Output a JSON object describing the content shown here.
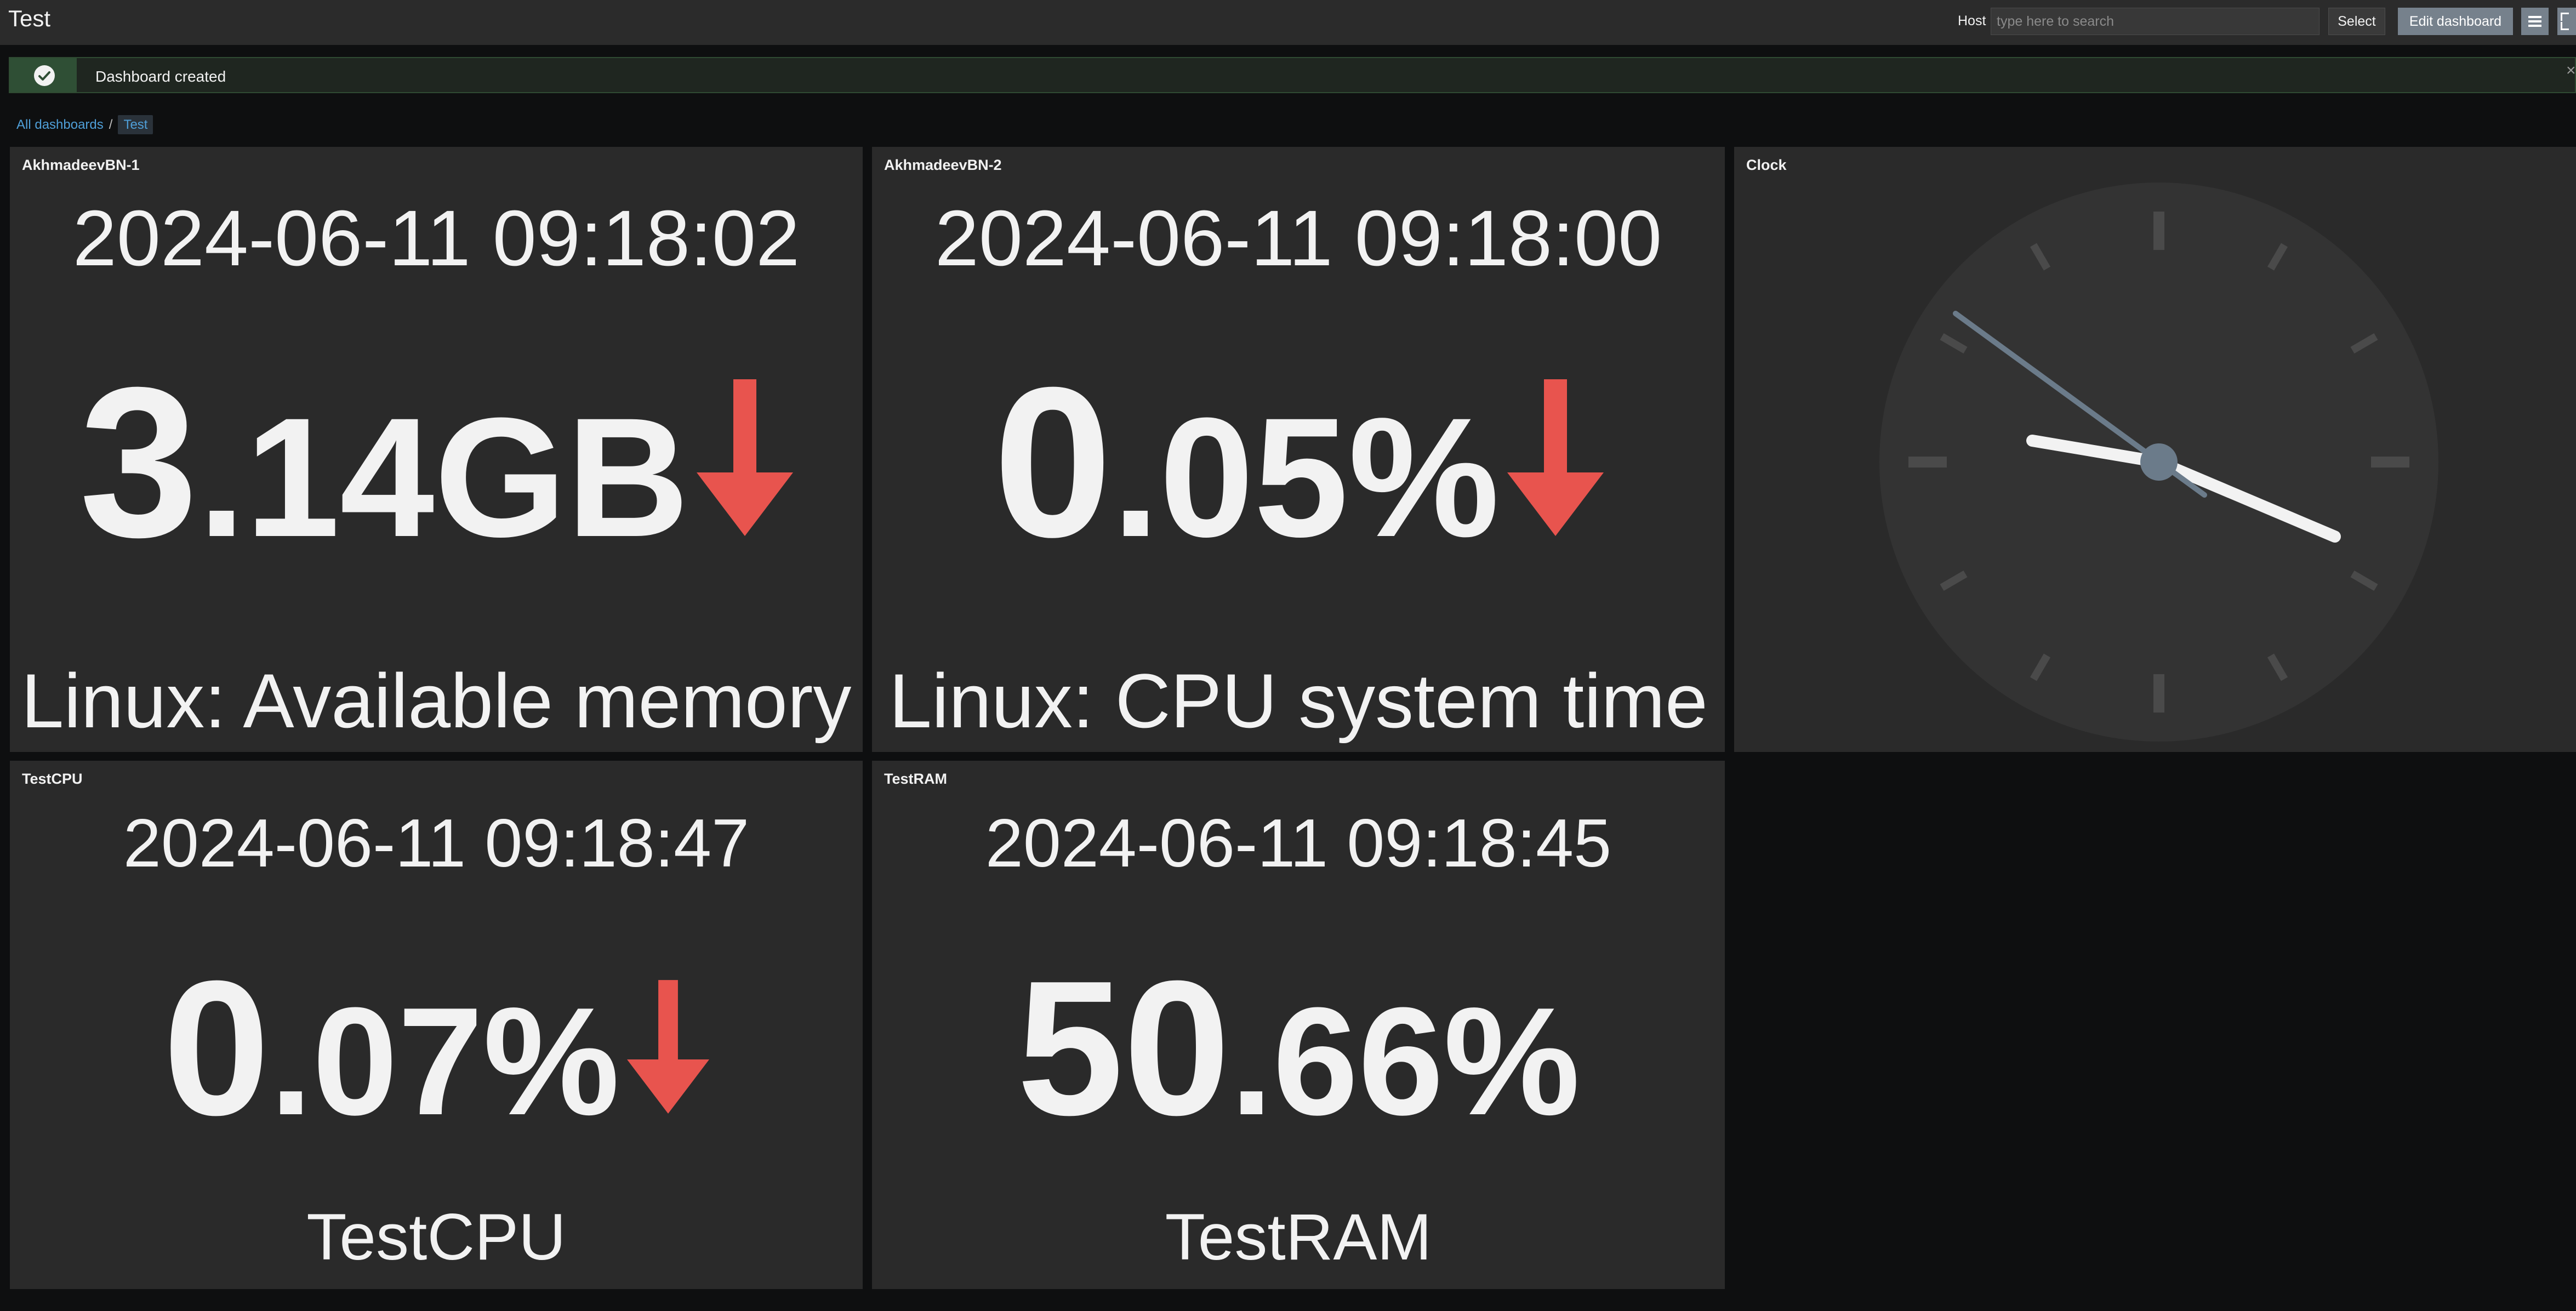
{
  "header": {
    "title": "Test",
    "host_label": "Host",
    "host_placeholder": "type here to search",
    "select_label": "Select",
    "edit_label": "Edit dashboard"
  },
  "message": {
    "text": "Dashboard created",
    "close": "×"
  },
  "breadcrumb": {
    "all": "All dashboards",
    "separator": "/",
    "current": "Test"
  },
  "widgets": [
    {
      "title": "AkhmadeevBN-1",
      "timestamp": "2024-06-11 09:18:02",
      "value_int": "3",
      "value_dec": ".14",
      "units": "GB",
      "trend": "down",
      "description": "Linux: Available memory"
    },
    {
      "title": "AkhmadeevBN-2",
      "timestamp": "2024-06-11 09:18:00",
      "value_int": "0",
      "value_dec": ".05",
      "units": "%",
      "trend": "down",
      "description": "Linux: CPU system time"
    },
    {
      "title": "TestCPU",
      "timestamp": "2024-06-11 09:18:47",
      "value_int": "0",
      "value_dec": ".07",
      "units": "%",
      "trend": "down",
      "description": "TestCPU"
    },
    {
      "title": "TestRAM",
      "timestamp": "2024-06-11 09:18:45",
      "value_int": "50",
      "value_dec": ".66",
      "units": "%",
      "trend": "none",
      "description": "TestRAM"
    }
  ],
  "clock": {
    "title": "Clock",
    "time": "09:18:00"
  },
  "colors": {
    "trend_down": "#e8544e",
    "widget_bg": "#2a2a2a",
    "page_bg": "#0e0f10",
    "accent_button": "#76818c",
    "link": "#4f9fd8"
  },
  "icons": {
    "success": "check-circle-icon",
    "menu": "hamburger-icon",
    "kiosk": "fullscreen-icon",
    "trend_down": "arrow-down-icon"
  }
}
